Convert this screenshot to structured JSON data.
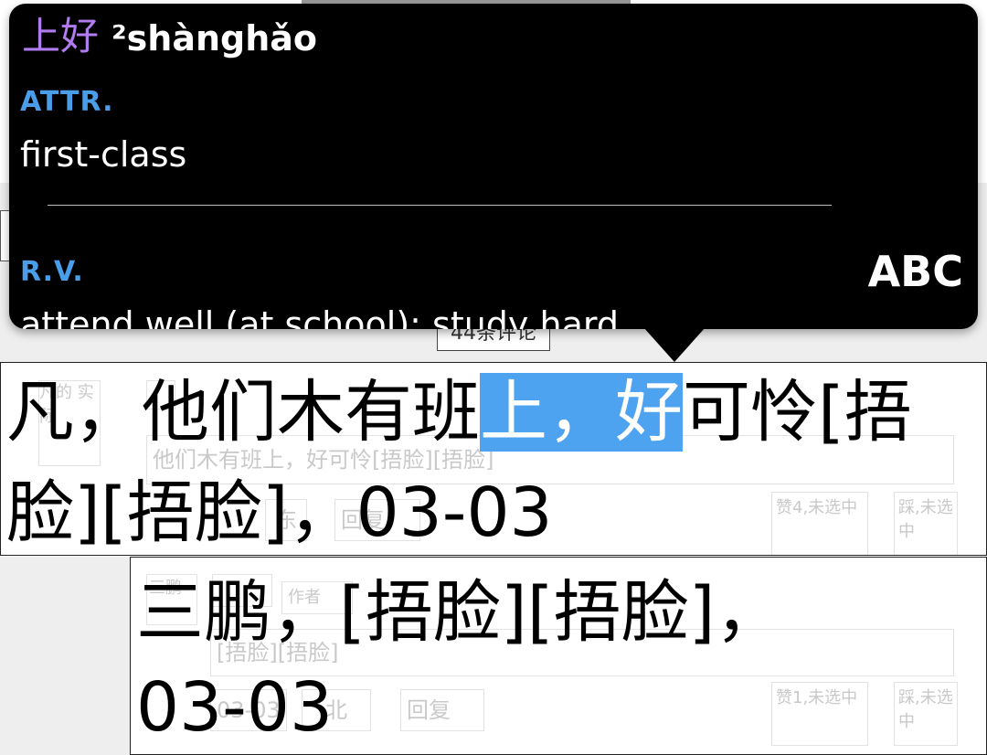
{
  "popup": {
    "word": "上好",
    "tone_reading": "²shànghǎo",
    "senses": [
      {
        "pos": "ATTR.",
        "definition": "first-class"
      },
      {
        "pos": "R.V.",
        "definition": "attend well (at school); study hard"
      }
    ],
    "toggle_button": "ABC",
    "colors": {
      "background": "#000000",
      "hanzi": "#b07cf0",
      "pos": "#4a9de8"
    }
  },
  "page": {
    "comments_count": "44条评论",
    "comment1": {
      "zoomed_line1_before": "凡，他们木有班",
      "zoomed_highlight": "上，好",
      "zoomed_line1_after": "可怜[捂",
      "zoomed_line2": "脸][捂脸]，03-03",
      "ghost_user": "凡的 实际",
      "ghost_text": "他们木有班上，好可怜[捂脸][捂脸]",
      "ghost_location": "东",
      "ghost_reply": "回复",
      "ghost_like": "赞4,未选中",
      "ghost_dislike": "踩,未选中"
    },
    "comment2": {
      "zoomed_line1": "三鹏，[捂脸][捂脸]，",
      "zoomed_line2": "03-03",
      "ghost_user": "三鹏",
      "ghost_author": "作者",
      "ghost_text": "[捂脸][捂脸]",
      "ghost_date": "03-03",
      "ghost_location": "北",
      "ghost_reply": "回复",
      "ghost_like": "赞1,未选中",
      "ghost_dislike": "踩,未选中"
    },
    "highlight_color": "#4da3f0"
  }
}
